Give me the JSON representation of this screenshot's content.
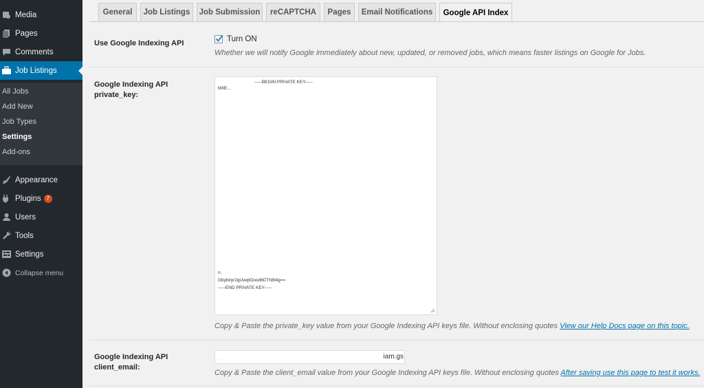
{
  "sidebar": {
    "media": "Media",
    "pages": "Pages",
    "comments": "Comments",
    "job_listings": "Job Listings",
    "submenu": [
      "All Jobs",
      "Add New",
      "Job Types",
      "Settings",
      "Add-ons"
    ],
    "appearance": "Appearance",
    "plugins": "Plugins",
    "plugins_badge": "7",
    "users": "Users",
    "tools": "Tools",
    "settings": "Settings",
    "collapse": "Collapse menu"
  },
  "tabs": [
    "General",
    "Job Listings",
    "Job Submission",
    "reCAPTCHA",
    "Pages",
    "Email Notifications",
    "Google API Index"
  ],
  "active_tab": "Google API Index",
  "fields": {
    "use_api": {
      "label": "Use Google Indexing API",
      "checkbox_label": "Turn ON",
      "checked": true,
      "description": "Whether we will notify Google immediately about new, updated, or removed jobs, which means faster listings on Google for Jobs."
    },
    "private_key": {
      "label_line1": "Google Indexing API",
      "label_line2": "private_key:",
      "value_lines": [
        "-----BEGIN PRIVATE KEY-----",
        "MIIE...",
        "n.",
        "Gbybl/yr2gUwqtOood6DTh8t4g==",
        "-----END PRIVATE KEY-----"
      ],
      "description": "Copy & Paste the private_key value from your Google Indexing API keys file. Without enclosing quotes",
      "link": "View our Help Docs page on this topic."
    },
    "client_email": {
      "label_line1": "Google Indexing API",
      "label_line2": "client_email:",
      "value_end": "iam.gs",
      "description": "Copy & Paste the client_email value from your Google Indexing API keys file. Without enclosing quotes",
      "link": "After saving use this page to test it works."
    }
  },
  "colors": {
    "sidebar_bg": "#23282d",
    "active_menu": "#0073aa",
    "badge": "#d54e21",
    "link": "#0073aa"
  }
}
